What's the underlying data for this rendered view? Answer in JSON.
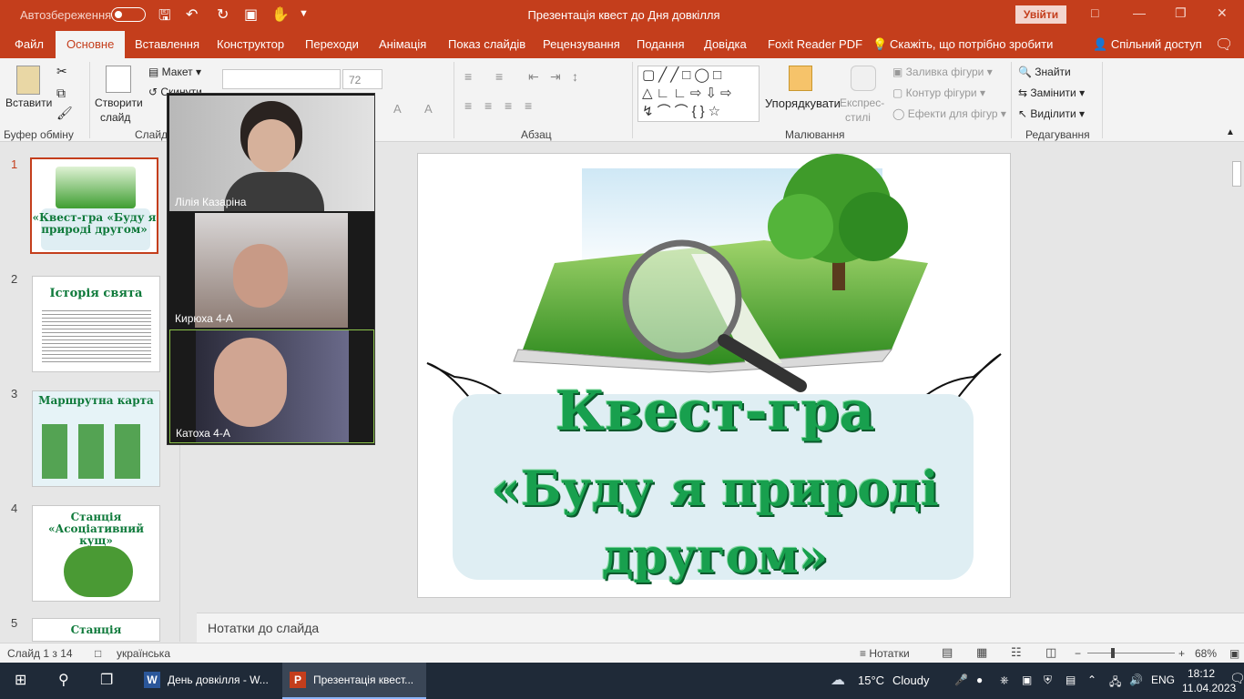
{
  "titlebar": {
    "autosave": "Автозбереження",
    "doc_title": "Презентація квест до Дня довкілля - PowerPoint",
    "doc_title_short": "Презентація квест до Дня довкілля",
    "signin": "Увійти"
  },
  "tabs": [
    {
      "label": "Файл"
    },
    {
      "label": "Основне"
    },
    {
      "label": "Вставлення"
    },
    {
      "label": "Конструктор"
    },
    {
      "label": "Переходи"
    },
    {
      "label": "Анімація"
    },
    {
      "label": "Показ слайдів"
    },
    {
      "label": "Рецензування"
    },
    {
      "label": "Подання"
    },
    {
      "label": "Довідка"
    },
    {
      "label": "Foxit Reader PDF"
    },
    {
      "label": "Скажіть, що потрібно зробити"
    }
  ],
  "share": "Спільний доступ",
  "ribbon": {
    "paste": "Вставити",
    "new_slide_1": "Створити",
    "new_slide_2": "слайд",
    "layout": "Макет",
    "reset": "Скинути",
    "font_size": "72",
    "arrange": "Упорядкувати",
    "quick_styles_1": "Експрес-",
    "quick_styles_2": "стилі",
    "shape_fill": "Заливка фігури",
    "shape_outline": "Контур фігури",
    "shape_effects": "Ефекти для фігур",
    "find": "Знайти",
    "replace": "Замінити",
    "select": "Виділити",
    "groups": {
      "clipboard": "Буфер обміну",
      "slides": "Слайди",
      "paragraph": "Абзац",
      "drawing": "Малювання",
      "editing": "Редагування"
    }
  },
  "thumbnails": [
    {
      "num": "1",
      "title": "«Квест-гра «Буду я природі другом»"
    },
    {
      "num": "2",
      "title": "Історія свята"
    },
    {
      "num": "3",
      "title": "Маршрутна карта"
    },
    {
      "num": "4",
      "title": "Станція «Асоціативний кущ»"
    },
    {
      "num": "5",
      "title": "Станція"
    }
  ],
  "slide": {
    "line1": "Квест-гра",
    "line2": "«Буду я природі",
    "line3": "другом»"
  },
  "video": [
    {
      "name": "Лілія Казаріна"
    },
    {
      "name": "Кирюха 4-А"
    },
    {
      "name": "Катоха 4-А"
    }
  ],
  "notes_placeholder": "Нотатки до слайда",
  "status": {
    "slide_of": "Слайд 1 з 14",
    "language": "українська",
    "notes": "Нотатки",
    "zoom": "68%"
  },
  "taskbar": {
    "word_task": "День довкілля - W...",
    "ppt_task": "Презентація квест...",
    "weather_temp": "15°C",
    "weather_text": "Cloudy",
    "lang": "ENG",
    "time": "18:12",
    "date": "11.04.2023"
  },
  "colors": {
    "accent": "#c43e1c",
    "title_green": "#18a04e",
    "banner": "#dfeef3",
    "taskbar": "#1f2a38"
  }
}
